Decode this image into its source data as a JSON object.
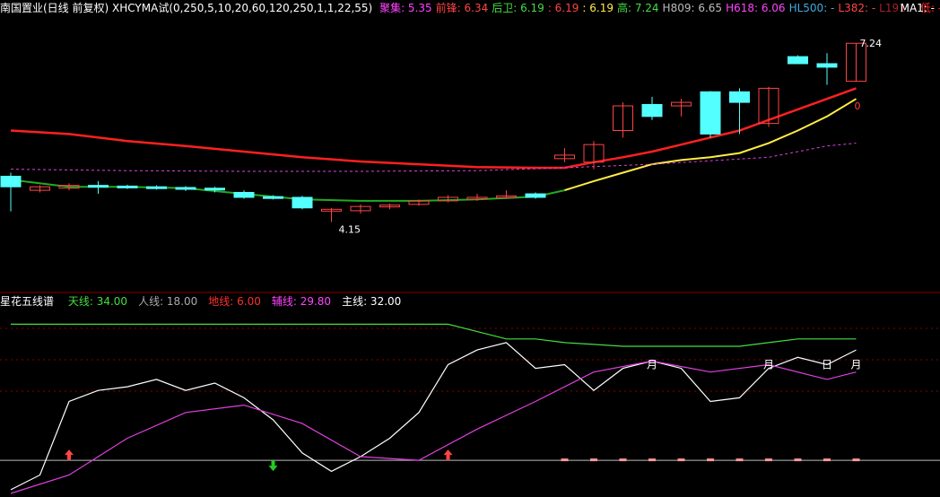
{
  "colors": {
    "background": "#000000",
    "up": "#ff4444",
    "down": "#54ffff",
    "grid": "#8b0000",
    "ma_long": "#ff2020",
    "ma_short_green": "#22aa22",
    "ma_short_yellow": "#ffee44",
    "white": "#ffffff",
    "magenta": "#e040e0",
    "tianxian": "#44dd44",
    "dixian": "#ff3030",
    "fuxian": "#ff44ff"
  },
  "header": {
    "title": "南国置业(日线 前复权)",
    "indicator": "XHCYMA试(0,250,5,10,20,60,120,250,1,1,22,55)",
    "items": [
      {
        "label": "聚集:",
        "value": "5.35",
        "color": "#ff44ff"
      },
      {
        "label": "前锋:",
        "value": "6.34",
        "color": "#ff4444"
      },
      {
        "label": "后卫:",
        "value": "6.19",
        "color": "#44dd44"
      },
      {
        "label": ":",
        "value": "6.19",
        "color": "#ff4444"
      },
      {
        "label": ":",
        "value": "6.19",
        "color": "#ffee44"
      },
      {
        "label": "高:",
        "value": "7.24",
        "color": "#44dd44"
      },
      {
        "label": "H809:",
        "value": "6.65",
        "color": "#bbbbbb"
      },
      {
        "label": "H618:",
        "value": "6.06",
        "color": "#ff44ff"
      },
      {
        "label": "HL500:",
        "value": "-",
        "color": "#44aadd"
      },
      {
        "label": "L382:",
        "value": "-",
        "color": "#ff4444"
      },
      {
        "label": "L191:",
        "value": "-",
        "color": "#aa2222"
      },
      {
        "label": "低:",
        "value": "-",
        "color": "#ff2020"
      }
    ],
    "ma_label": "MA1: -"
  },
  "sub_header": {
    "title": "星花五线谱",
    "items": [
      {
        "label": "天线:",
        "value": "34.00",
        "color": "#44dd44"
      },
      {
        "label": "人线:",
        "value": "18.00",
        "color": "#aaaaaa"
      },
      {
        "label": "地线:",
        "value": "6.00",
        "color": "#ff3030"
      },
      {
        "label": "辅线:",
        "value": "29.80",
        "color": "#ff44ff"
      },
      {
        "label": "主线:",
        "value": "32.00",
        "color": "#ffffff"
      }
    ]
  },
  "chart_data": [
    {
      "type": "candlestick",
      "yrange": [
        3.8,
        7.6
      ],
      "x_count": 30,
      "annotations": {
        "high_label": "7.24",
        "low_label": "4.15",
        "zero_label": "0"
      },
      "candles": [
        {
          "i": 0,
          "o": 5.35,
          "c": 5.2,
          "h": 5.4,
          "l": 4.85
        },
        {
          "i": 1,
          "o": 5.15,
          "c": 5.2,
          "h": 5.22,
          "l": 5.12
        },
        {
          "i": 2,
          "o": 5.18,
          "c": 5.22,
          "h": 5.25,
          "l": 5.15
        },
        {
          "i": 3,
          "o": 5.22,
          "c": 5.2,
          "h": 5.28,
          "l": 5.1
        },
        {
          "i": 4,
          "o": 5.21,
          "c": 5.19,
          "h": 5.23,
          "l": 5.17
        },
        {
          "i": 5,
          "o": 5.2,
          "c": 5.19,
          "h": 5.22,
          "l": 5.16
        },
        {
          "i": 6,
          "o": 5.19,
          "c": 5.17,
          "h": 5.21,
          "l": 5.14
        },
        {
          "i": 7,
          "o": 5.18,
          "c": 5.16,
          "h": 5.2,
          "l": 5.12
        },
        {
          "i": 8,
          "o": 5.12,
          "c": 5.05,
          "h": 5.15,
          "l": 5.03
        },
        {
          "i": 9,
          "o": 5.06,
          "c": 5.05,
          "h": 5.08,
          "l": 5.02
        },
        {
          "i": 10,
          "o": 5.05,
          "c": 4.9,
          "h": 5.07,
          "l": 4.88
        },
        {
          "i": 11,
          "o": 4.86,
          "c": 4.88,
          "h": 4.9,
          "l": 4.7
        },
        {
          "i": 12,
          "o": 4.86,
          "c": 4.92,
          "h": 4.95,
          "l": 4.82
        },
        {
          "i": 13,
          "o": 4.92,
          "c": 4.94,
          "h": 4.96,
          "l": 4.88
        },
        {
          "i": 14,
          "o": 4.95,
          "c": 5.0,
          "h": 5.02,
          "l": 4.93
        },
        {
          "i": 15,
          "o": 5.0,
          "c": 5.05,
          "h": 5.08,
          "l": 4.98
        },
        {
          "i": 16,
          "o": 5.03,
          "c": 5.05,
          "h": 5.1,
          "l": 5.0
        },
        {
          "i": 17,
          "o": 5.05,
          "c": 5.07,
          "h": 5.15,
          "l": 5.03
        },
        {
          "i": 18,
          "o": 5.1,
          "c": 5.05,
          "h": 5.12,
          "l": 5.03
        },
        {
          "i": 19,
          "o": 5.6,
          "c": 5.65,
          "h": 5.75,
          "l": 5.55
        },
        {
          "i": 20,
          "o": 5.55,
          "c": 5.8,
          "h": 5.85,
          "l": 5.45
        },
        {
          "i": 21,
          "o": 6.0,
          "c": 6.35,
          "h": 6.4,
          "l": 5.9
        },
        {
          "i": 22,
          "o": 6.37,
          "c": 6.2,
          "h": 6.48,
          "l": 6.15
        },
        {
          "i": 23,
          "o": 6.35,
          "c": 6.4,
          "h": 6.45,
          "l": 6.2
        },
        {
          "i": 24,
          "o": 6.55,
          "c": 5.95,
          "h": 6.56,
          "l": 5.9
        },
        {
          "i": 25,
          "o": 6.55,
          "c": 6.4,
          "h": 6.6,
          "l": 5.95
        },
        {
          "i": 26,
          "o": 6.1,
          "c": 6.6,
          "h": 6.62,
          "l": 6.05
        },
        {
          "i": 27,
          "o": 7.05,
          "c": 6.95,
          "h": 7.07,
          "l": 6.95
        },
        {
          "i": 28,
          "o": 6.95,
          "c": 6.9,
          "h": 7.1,
          "l": 6.65
        },
        {
          "i": 29,
          "o": 6.7,
          "c": 7.24,
          "h": 7.24,
          "l": 6.7
        }
      ],
      "series": [
        {
          "key": "ma_long",
          "points": [
            [
              0,
              6.0
            ],
            [
              2,
              5.95
            ],
            [
              4,
              5.85
            ],
            [
              6,
              5.78
            ],
            [
              8,
              5.7
            ],
            [
              10,
              5.62
            ],
            [
              12,
              5.56
            ],
            [
              14,
              5.52
            ],
            [
              16,
              5.48
            ],
            [
              18,
              5.47
            ],
            [
              19,
              5.47
            ],
            [
              20,
              5.55
            ],
            [
              21,
              5.62
            ],
            [
              22,
              5.7
            ],
            [
              23,
              5.8
            ],
            [
              24,
              5.9
            ],
            [
              25,
              6.0
            ],
            [
              26,
              6.15
            ],
            [
              27,
              6.3
            ],
            [
              28,
              6.45
            ],
            [
              29,
              6.6
            ]
          ]
        },
        {
          "key": "ma_short",
          "points": [
            [
              0,
              5.3
            ],
            [
              2,
              5.2
            ],
            [
              4,
              5.2
            ],
            [
              6,
              5.18
            ],
            [
              8,
              5.1
            ],
            [
              10,
              5.02
            ],
            [
              12,
              5.0
            ],
            [
              14,
              5.0
            ],
            [
              16,
              5.02
            ],
            [
              18,
              5.06
            ],
            [
              19,
              5.15
            ],
            [
              20,
              5.28
            ],
            [
              21,
              5.4
            ],
            [
              22,
              5.52
            ],
            [
              23,
              5.58
            ],
            [
              24,
              5.62
            ],
            [
              25,
              5.68
            ],
            [
              26,
              5.82
            ],
            [
              27,
              6.0
            ],
            [
              28,
              6.2
            ],
            [
              29,
              6.45
            ]
          ]
        },
        {
          "key": "dashed_low",
          "points": [
            [
              0,
              5.45
            ],
            [
              4,
              5.43
            ],
            [
              8,
              5.42
            ],
            [
              12,
              5.42
            ],
            [
              16,
              5.43
            ],
            [
              19,
              5.47
            ],
            [
              22,
              5.52
            ],
            [
              24,
              5.57
            ],
            [
              26,
              5.62
            ],
            [
              28,
              5.78
            ],
            [
              29,
              5.82
            ]
          ]
        }
      ]
    },
    {
      "type": "line",
      "yrange": [
        0,
        100
      ],
      "series": [
        {
          "name": "天线",
          "key": "tianxian",
          "points": [
            [
              0,
              92
            ],
            [
              15,
              92
            ],
            [
              16,
              88
            ],
            [
              17,
              84
            ],
            [
              18,
              84
            ],
            [
              19,
              82
            ],
            [
              20,
              81
            ],
            [
              21,
              80
            ],
            [
              22,
              80
            ],
            [
              23,
              80
            ],
            [
              24,
              80
            ],
            [
              25,
              80
            ],
            [
              26,
              82
            ],
            [
              27,
              84
            ],
            [
              28,
              84
            ],
            [
              29,
              84
            ]
          ]
        },
        {
          "name": "主线",
          "key": "zhuxian",
          "points": [
            [
              0,
              2
            ],
            [
              1,
              10
            ],
            [
              2,
              50
            ],
            [
              3,
              56
            ],
            [
              4,
              58
            ],
            [
              5,
              62
            ],
            [
              6,
              56
            ],
            [
              7,
              60
            ],
            [
              8,
              52
            ],
            [
              9,
              40
            ],
            [
              10,
              22
            ],
            [
              11,
              12
            ],
            [
              12,
              20
            ],
            [
              13,
              30
            ],
            [
              14,
              44
            ],
            [
              15,
              70
            ],
            [
              16,
              78
            ],
            [
              17,
              82
            ],
            [
              18,
              68
            ],
            [
              19,
              70
            ],
            [
              20,
              56
            ],
            [
              21,
              68
            ],
            [
              22,
              72
            ],
            [
              23,
              68
            ],
            [
              24,
              50
            ],
            [
              25,
              52
            ],
            [
              26,
              68
            ],
            [
              27,
              74
            ],
            [
              28,
              70
            ],
            [
              29,
              78
            ]
          ]
        },
        {
          "name": "辅线",
          "key": "fuxian",
          "points": [
            [
              0,
              0
            ],
            [
              2,
              10
            ],
            [
              4,
              30
            ],
            [
              6,
              44
            ],
            [
              8,
              48
            ],
            [
              10,
              38
            ],
            [
              12,
              20
            ],
            [
              14,
              18
            ],
            [
              16,
              35
            ],
            [
              18,
              50
            ],
            [
              20,
              66
            ],
            [
              22,
              72
            ],
            [
              24,
              66
            ],
            [
              26,
              70
            ],
            [
              28,
              62
            ],
            [
              29,
              66
            ]
          ]
        }
      ],
      "labels": [
        "月",
        "月",
        "日",
        "月"
      ],
      "baseline": 18
    }
  ]
}
